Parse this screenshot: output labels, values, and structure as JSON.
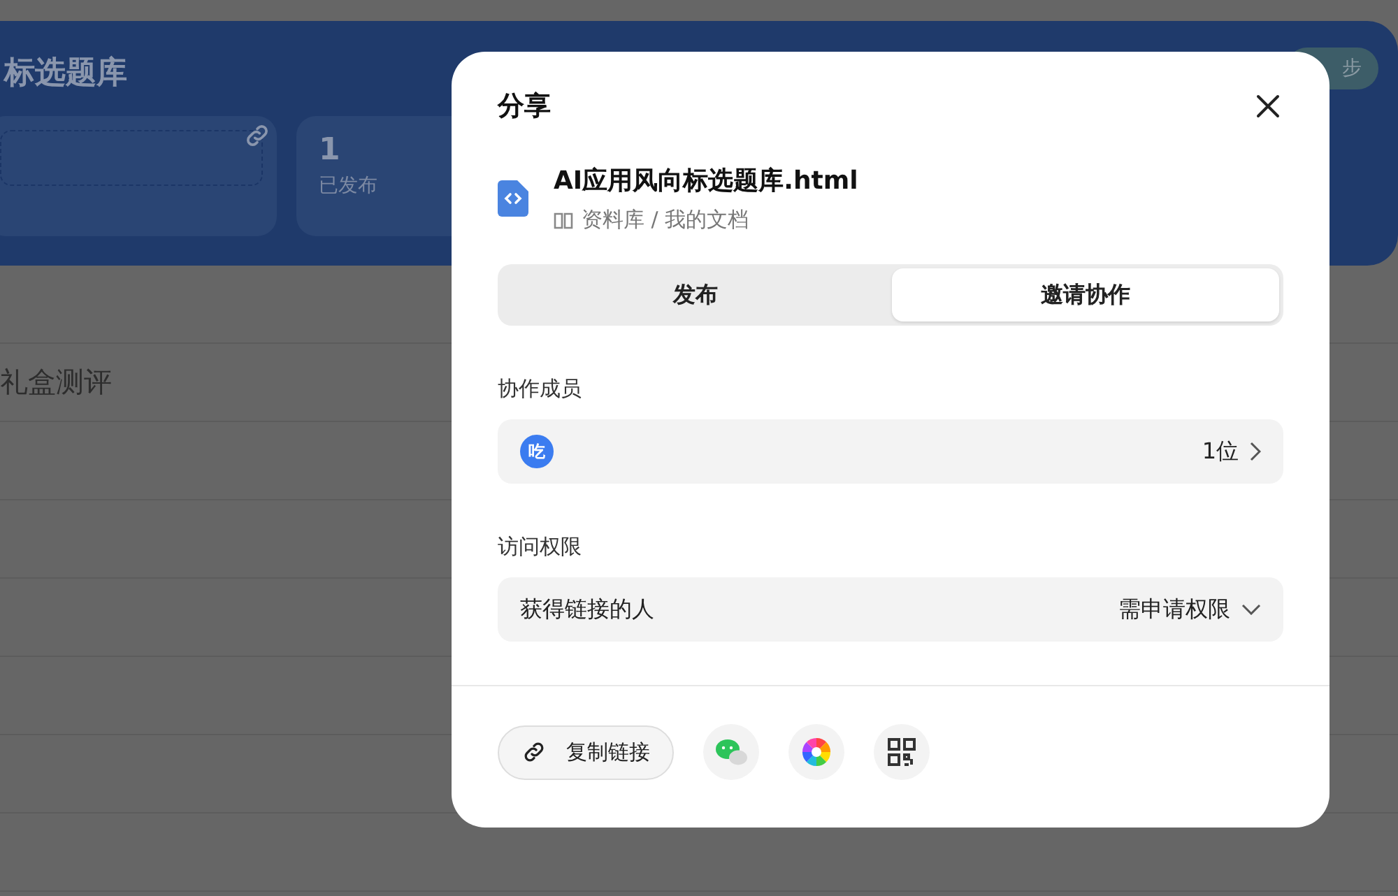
{
  "page": {
    "title": "标选题库",
    "sync_button": "步",
    "stats": [
      {
        "value": "1",
        "label": "已发布"
      }
    ],
    "rows": [
      {
        "title": "礼盒测评"
      }
    ]
  },
  "dialog": {
    "title": "分享",
    "file": {
      "name": "AI应用风向标选题库.html",
      "path": "资料库 / 我的文档"
    },
    "tabs": [
      {
        "label": "发布",
        "selected": false
      },
      {
        "label": "邀请协作",
        "selected": true
      }
    ],
    "members": {
      "label": "协作成员",
      "avatar": "吃",
      "count": "1位"
    },
    "access": {
      "label": "访问权限",
      "who": "获得链接的人",
      "permission": "需申请权限"
    },
    "actions": {
      "copy_link": "复制链接",
      "share_targets": [
        {
          "kind": "wechat"
        },
        {
          "kind": "moments"
        },
        {
          "kind": "qrcode"
        }
      ]
    }
  }
}
